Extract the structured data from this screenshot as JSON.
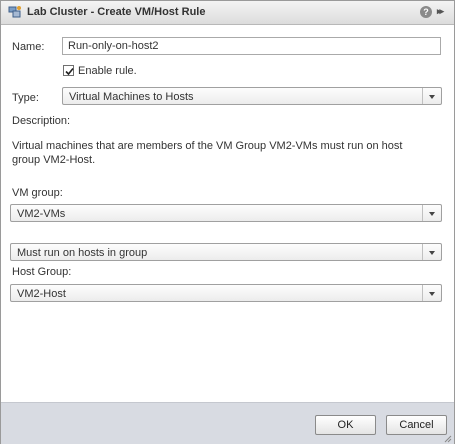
{
  "window": {
    "title": "Lab Cluster - Create VM/Host Rule",
    "help_glyph": "?",
    "expand_glyph": "▸▸"
  },
  "form": {
    "name_label": "Name:",
    "name_value": "Run-only-on-host2",
    "enable_label": "Enable rule.",
    "enable_checked": true,
    "type_label": "Type:",
    "type_value": "Virtual Machines to Hosts",
    "description_label": "Description:",
    "description_text": "Virtual machines that are members of the VM Group VM2-VMs must run on host group VM2-Host.",
    "vm_group_label": "VM group:",
    "vm_group_value": "VM2-VMs",
    "rule_value": "Must run on hosts in group",
    "host_group_label": "Host Group:",
    "host_group_value": "VM2-Host"
  },
  "footer": {
    "ok_label": "OK",
    "cancel_label": "Cancel"
  }
}
